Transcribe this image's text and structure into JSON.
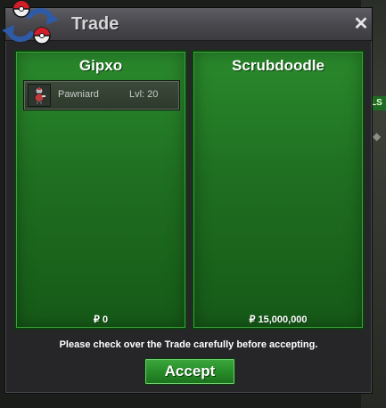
{
  "window": {
    "title": "Trade",
    "close_icon": "close-icon"
  },
  "left_panel": {
    "player_name": "Gipxo",
    "items": [
      {
        "name": "Pawniard",
        "level": "Lvl: 20",
        "icon": "pawniard-sprite-icon"
      }
    ],
    "money": "₽ 0"
  },
  "right_panel": {
    "player_name": "Scrubdoodle",
    "items": [],
    "money": "₽ 15,000,000"
  },
  "notice": "Please check over the Trade carefully before accepting.",
  "accept_label": "Accept",
  "colors": {
    "panel_green": "#1f6f21",
    "accent_green": "#268a27",
    "title_bar": "#47474c"
  }
}
